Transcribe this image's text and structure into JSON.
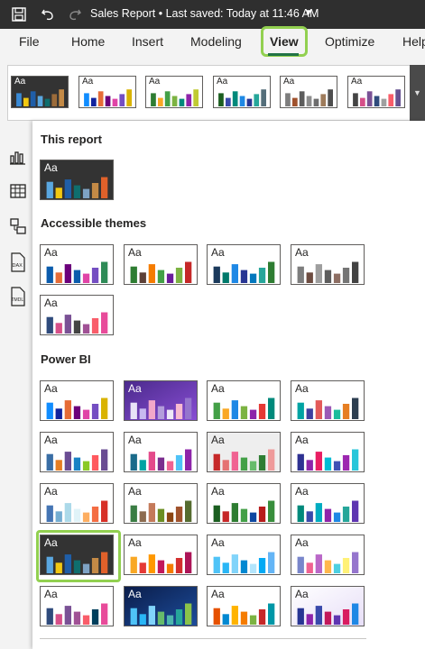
{
  "titlebar": {
    "title": "Sales Report • Last saved: Today at 11:46 AM",
    "caret": "▼",
    "icons": [
      "save-icon",
      "undo-icon",
      "redo-icon"
    ]
  },
  "ribbon": {
    "tabs": [
      "File",
      "Home",
      "Insert",
      "Modeling",
      "View",
      "Optimize",
      "Help"
    ],
    "active_tab": "View",
    "accent": "#217346",
    "highlight_color": "#92d050"
  },
  "left_rail": {
    "icons": [
      "report-view-icon",
      "table-view-icon",
      "model-view-icon",
      "dax-query-view-icon",
      "tmdl-view-icon"
    ],
    "labels": {
      "dax": "DAX",
      "tmdl": "TMDL"
    }
  },
  "strip": {
    "themes": [
      {
        "dark": true,
        "colors": [
          "#3a8ad6",
          "#f2c811",
          "#1f5ea8",
          "#5aa7e0",
          "#0f6e6e",
          "#9c6b3a",
          "#c48a46"
        ]
      },
      {
        "dark": false,
        "colors": [
          "#118dff",
          "#12239e",
          "#e66c37",
          "#6b007b",
          "#e044a7",
          "#744ec2",
          "#d9b300"
        ]
      },
      {
        "dark": false,
        "colors": [
          "#2e7d32",
          "#f9a825",
          "#43a047",
          "#7cb342",
          "#00897b",
          "#8e24aa",
          "#c0ca33"
        ]
      },
      {
        "dark": false,
        "colors": [
          "#1b5e20",
          "#3949ab",
          "#00897b",
          "#1e88e5",
          "#283593",
          "#26a69a",
          "#546e7a"
        ]
      },
      {
        "dark": false,
        "colors": [
          "#7d7d7d",
          "#a0522d",
          "#5d5d5d",
          "#8d8d8d",
          "#6d6d6d",
          "#9e7b5b",
          "#4e4e4e"
        ]
      },
      {
        "dark": false,
        "colors": [
          "#444444",
          "#d64f89",
          "#7a5195",
          "#2f4b7c",
          "#a0a0a0",
          "#f95d6a",
          "#665191"
        ]
      }
    ]
  },
  "gallery": {
    "sample_text": "Aa",
    "sections": [
      {
        "title": "This report"
      },
      {
        "title": "Accessible themes"
      },
      {
        "title": "Power BI"
      }
    ],
    "this_report": [
      {
        "dark": true,
        "colors": [
          "#5aa7e0",
          "#f2c811",
          "#1f5ea8",
          "#0f6e6e",
          "#7ea3c4",
          "#c48a46",
          "#e0612a"
        ]
      }
    ],
    "accessible": [
      {
        "colors": [
          "#0b5cad",
          "#e66c37",
          "#6b007b",
          "#0b5cad",
          "#e044a7",
          "#744ec2",
          "#2e8b57"
        ]
      },
      {
        "colors": [
          "#2e7d32",
          "#5d4037",
          "#f57c00",
          "#43a047",
          "#6a1b9a",
          "#7cb342",
          "#c62828"
        ]
      },
      {
        "colors": [
          "#1b3a5c",
          "#00796b",
          "#1e88e5",
          "#283593",
          "#0277bd",
          "#26a69a",
          "#2e7d32"
        ]
      },
      {
        "colors": [
          "#7d7d7d",
          "#6d4c41",
          "#9e9e9e",
          "#5d5d5d",
          "#8d6e63",
          "#757575",
          "#424242"
        ]
      },
      {
        "colors": [
          "#2f4b7c",
          "#d64f89",
          "#7a5195",
          "#444444",
          "#a05195",
          "#f95d6a",
          "#e84b9a"
        ]
      }
    ],
    "powerbi": [
      {
        "colors": [
          "#118dff",
          "#12239e",
          "#e66c37",
          "#6b007b",
          "#e044a7",
          "#744ec2",
          "#d9b300"
        ]
      },
      {
        "bg": "purple",
        "colors": [
          "#e8e3f7",
          "#c7b9f0",
          "#f2a7c9",
          "#b39ddb",
          "#ede7f6",
          "#f8bbd0",
          "#9575cd"
        ]
      },
      {
        "colors": [
          "#43a047",
          "#f9a825",
          "#1e88e5",
          "#7cb342",
          "#8e24aa",
          "#e53935",
          "#00897b"
        ]
      },
      {
        "colors": [
          "#00a3a3",
          "#3f3f9f",
          "#e35a5a",
          "#9b59b6",
          "#1abc9c",
          "#e67e22",
          "#2c3e50"
        ]
      },
      {
        "colors": [
          "#3a6ea5",
          "#e67e22",
          "#6a4c93",
          "#1982c4",
          "#8ac926",
          "#ff595e",
          "#6a4c93"
        ]
      },
      {
        "colors": [
          "#1a6b8a",
          "#00a3a3",
          "#e44a8b",
          "#7b2d8e",
          "#f06292",
          "#4fc3f7",
          "#8e24aa"
        ]
      },
      {
        "bg": "lightgray",
        "colors": [
          "#c62828",
          "#e57373",
          "#f06292",
          "#43a047",
          "#66bb6a",
          "#2e7d32",
          "#ef9a9a"
        ]
      },
      {
        "colors": [
          "#2e3192",
          "#8e24aa",
          "#e91e63",
          "#00bcd4",
          "#3f51b5",
          "#9c27b0",
          "#26c6da"
        ]
      },
      {
        "colors": [
          "#4575b4",
          "#74add1",
          "#abd9e9",
          "#e0f3f8",
          "#fdae61",
          "#f46d43",
          "#d73027"
        ]
      },
      {
        "colors": [
          "#3a7d44",
          "#8c6b4f",
          "#c47a5a",
          "#6b8e23",
          "#8b4513",
          "#a0522d",
          "#556b2f"
        ]
      },
      {
        "colors": [
          "#1b5e20",
          "#c62828",
          "#2e7d32",
          "#43a047",
          "#0d47a1",
          "#b71c1c",
          "#388e3c"
        ]
      },
      {
        "colors": [
          "#00897b",
          "#3949ab",
          "#00acc1",
          "#8e24aa",
          "#1e88e5",
          "#26a69a",
          "#5e35b1"
        ]
      },
      {
        "dark": true,
        "colors": [
          "#5aa7e0",
          "#f2c811",
          "#1f5ea8",
          "#0f6e6e",
          "#7ea3c4",
          "#c48a46",
          "#e0612a"
        ]
      },
      {
        "colors": [
          "#f9a825",
          "#e53935",
          "#ff9800",
          "#c2185b",
          "#f57c00",
          "#d32f2f",
          "#ad1457"
        ]
      },
      {
        "colors": [
          "#4fc3f7",
          "#29b6f6",
          "#81d4fa",
          "#0288d1",
          "#b3e5fc",
          "#03a9f4",
          "#64b5f6"
        ]
      },
      {
        "colors": [
          "#7986cb",
          "#f06292",
          "#ba68c8",
          "#ffb74d",
          "#4dd0e1",
          "#fff176",
          "#9575cd"
        ]
      },
      {
        "colors": [
          "#2f4b7c",
          "#d64f89",
          "#7a5195",
          "#a05195",
          "#f95d6a",
          "#003f5c",
          "#e84b9a"
        ]
      },
      {
        "bg": "navy",
        "colors": [
          "#4fc3f7",
          "#29b6f6",
          "#81d4fa",
          "#66bb6a",
          "#4db6ac",
          "#26a69a",
          "#8bc34a"
        ]
      },
      {
        "colors": [
          "#e65100",
          "#0288d1",
          "#ffb300",
          "#f57c00",
          "#7cb342",
          "#c62828",
          "#0097a7"
        ]
      },
      {
        "bg": "lavender",
        "colors": [
          "#283593",
          "#8e24aa",
          "#3949ab",
          "#c2185b",
          "#5e35b1",
          "#d81b60",
          "#1e88e5"
        ]
      }
    ]
  }
}
